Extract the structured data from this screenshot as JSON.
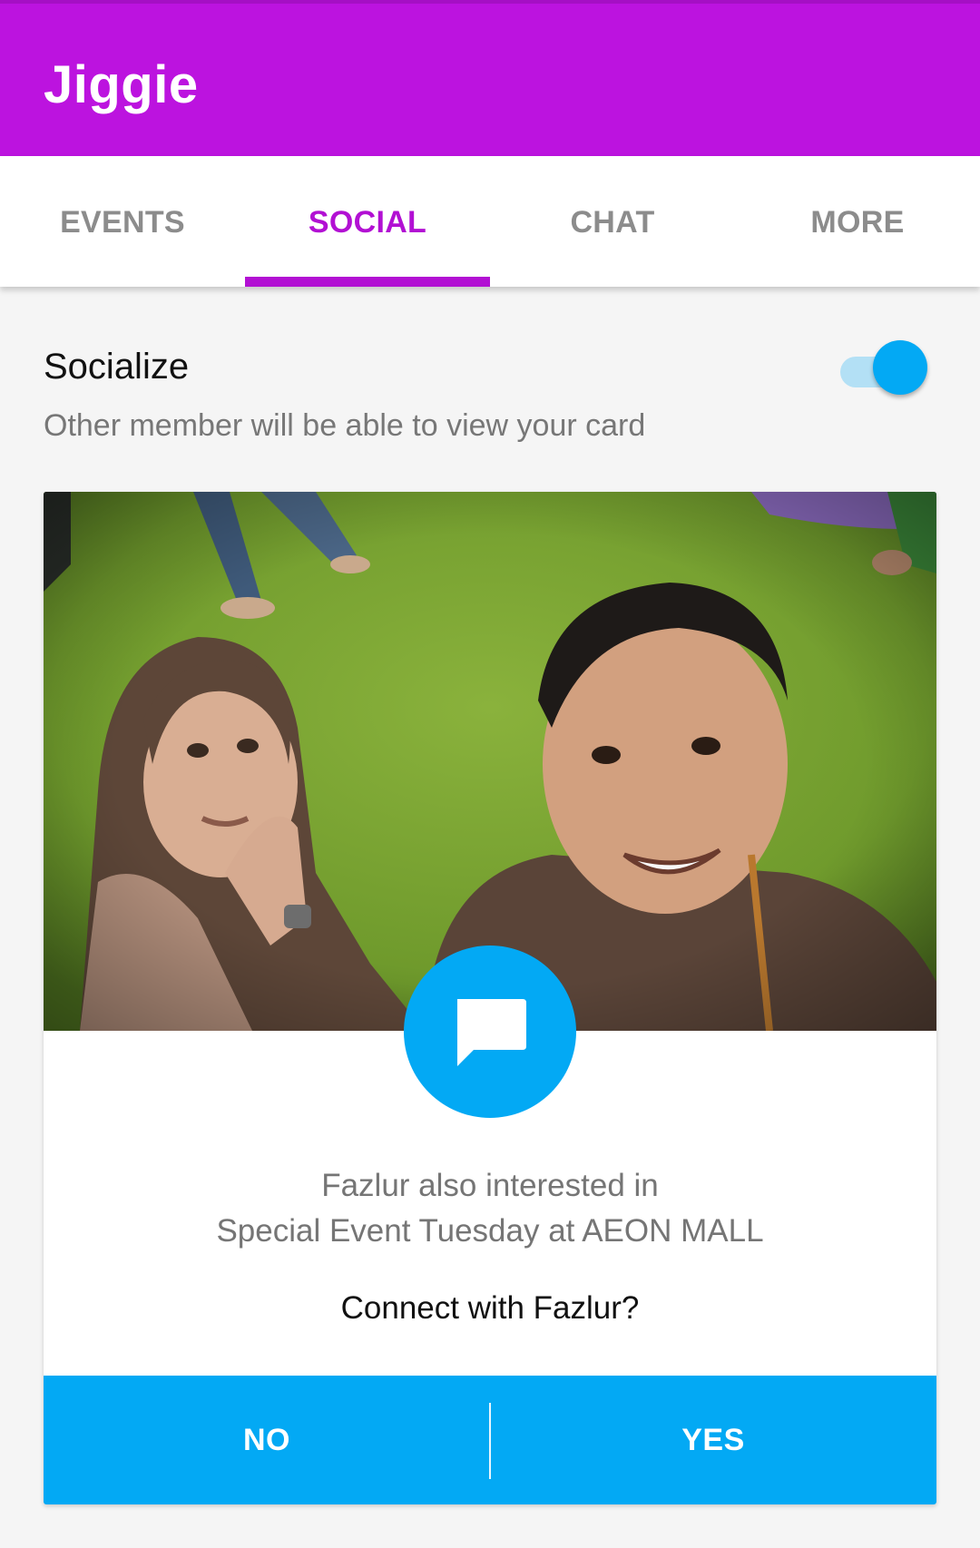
{
  "app": {
    "title": "Jiggie",
    "brand_color": "#bc13df",
    "accent_color": "#03a9f4"
  },
  "tabs": [
    {
      "label": "EVENTS",
      "active": false
    },
    {
      "label": "SOCIAL",
      "active": true
    },
    {
      "label": "CHAT",
      "active": false
    },
    {
      "label": "MORE",
      "active": false
    }
  ],
  "socialize": {
    "title": "Socialize",
    "subtitle": "Other member will be able to view your card",
    "toggle_on": true
  },
  "card": {
    "photo_icon": "profile-photo",
    "fab_icon": "chat-bubble-icon",
    "interest_line1": "Fazlur also interested in",
    "interest_line2": "Special Event Tuesday at AEON MALL",
    "connect_prompt": "Connect with Fazlur?",
    "no_label": "NO",
    "yes_label": "YES"
  }
}
